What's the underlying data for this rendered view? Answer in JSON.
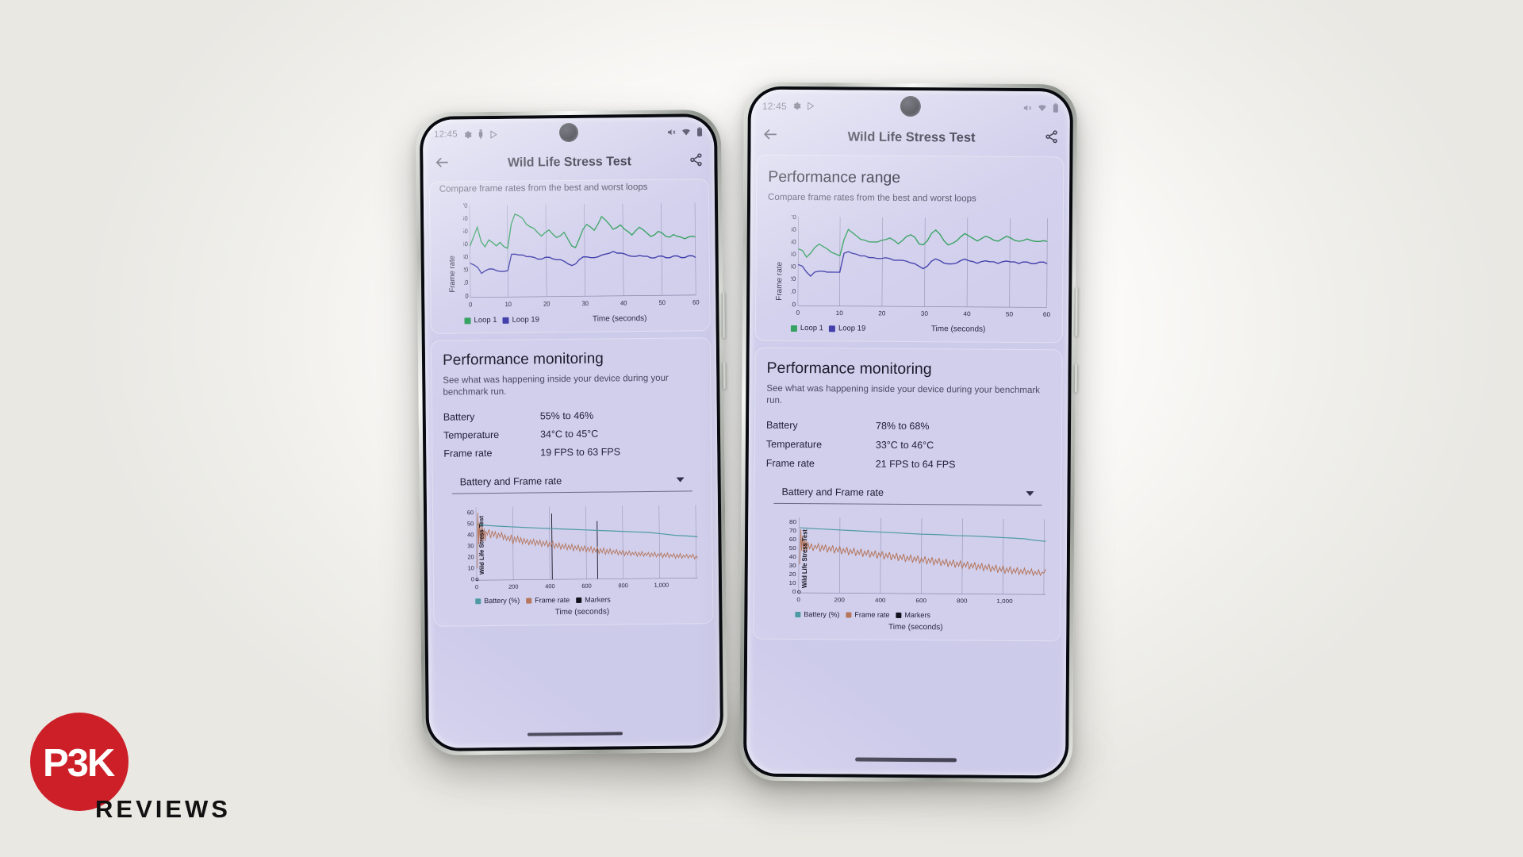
{
  "scene": {
    "background_color": "#f2f1ee",
    "watermark": {
      "brand_mark": "P3K",
      "brand_text": "REVIEWS",
      "brand_color": "#cd1f28"
    }
  },
  "phones": [
    {
      "id": "left-phone",
      "status_bar": {
        "time": "12:45",
        "left_icons": [
          "gear-icon",
          "usb-icon",
          "play-store-icon"
        ],
        "right_icons": [
          "mute-icon",
          "wifi-icon",
          "battery-icon"
        ]
      },
      "app_bar": {
        "back_icon": "back-arrow-icon",
        "title": "Wild Life Stress Test",
        "share_icon": "share-icon"
      },
      "performance_range": {
        "subtitle": "Compare frame rates from the best and worst loops",
        "axis_label_x": "Time (seconds)",
        "axis_label_y": "Frame rate",
        "legend": [
          {
            "label": "Loop 1",
            "color": "#2e9e5b"
          },
          {
            "label": "Loop 19",
            "color": "#3d3aa8"
          }
        ]
      },
      "performance_monitoring": {
        "title": "Performance monitoring",
        "subtitle": "See what was happening inside your device during your benchmark run.",
        "rows": [
          {
            "key": "Battery",
            "value": "55% to 46%"
          },
          {
            "key": "Temperature",
            "value": "34°C to 45°C"
          },
          {
            "key": "Frame rate",
            "value": "19 FPS to 63 FPS"
          }
        ],
        "dropdown_value": "Battery and Frame rate",
        "chart": {
          "axis_label_x": "Time (seconds)",
          "axis_label_y": "Wild Life Stress Test",
          "legend": [
            {
              "label": "Battery (%)",
              "color": "#4e9aa4"
            },
            {
              "label": "Frame rate",
              "color": "#b5765c"
            },
            {
              "label": "Markers",
              "color": "#11111e"
            }
          ]
        }
      }
    },
    {
      "id": "right-phone",
      "status_bar": {
        "time": "12:45",
        "left_icons": [
          "gear-icon",
          "play-store-icon"
        ],
        "right_icons": [
          "mute-icon",
          "wifi-icon",
          "battery-icon"
        ]
      },
      "app_bar": {
        "back_icon": "back-arrow-icon",
        "title": "Wild Life Stress Test",
        "share_icon": "share-icon"
      },
      "performance_range": {
        "title": "Performance range",
        "subtitle": "Compare frame rates from the best and worst loops",
        "axis_label_x": "Time (seconds)",
        "axis_label_y": "Frame rate",
        "legend": [
          {
            "label": "Loop 1",
            "color": "#2e9e5b"
          },
          {
            "label": "Loop 19",
            "color": "#3d3aa8"
          }
        ]
      },
      "performance_monitoring": {
        "title": "Performance monitoring",
        "subtitle": "See what was happening inside your device during your benchmark run.",
        "rows": [
          {
            "key": "Battery",
            "value": "78% to 68%"
          },
          {
            "key": "Temperature",
            "value": "33°C to 46°C"
          },
          {
            "key": "Frame rate",
            "value": "21 FPS to 64 FPS"
          }
        ],
        "dropdown_value": "Battery and Frame rate",
        "chart": {
          "axis_label_x": "Time (seconds)",
          "axis_label_y": "Wild Life Stress Test",
          "legend": [
            {
              "label": "Battery (%)",
              "color": "#4e9aa4"
            },
            {
              "label": "Frame rate",
              "color": "#b5765c"
            },
            {
              "label": "Markers",
              "color": "#11111e"
            }
          ]
        }
      }
    }
  ],
  "chart_data": [
    {
      "id": "left-performance-range",
      "type": "line",
      "title": "Performance range",
      "xlabel": "Time (seconds)",
      "ylabel": "Frame rate",
      "xlim": [
        0,
        60
      ],
      "ylim": [
        0,
        70
      ],
      "xticks": [
        0,
        10,
        20,
        30,
        40,
        50,
        60
      ],
      "yticks": [
        0,
        10,
        20,
        30,
        40,
        50,
        60,
        70
      ],
      "grid": true,
      "legend_position": "bottom-left",
      "series": [
        {
          "name": "Loop 1",
          "color": "#2e9e5b",
          "x": [
            0,
            1,
            2,
            3,
            4,
            5,
            6,
            7,
            8,
            9,
            10,
            11,
            12,
            13,
            14,
            15,
            16,
            17,
            18,
            19,
            20,
            21,
            22,
            23,
            24,
            25,
            26,
            27,
            28,
            29,
            30,
            31,
            32,
            33,
            34,
            35,
            36,
            37,
            38,
            39,
            40,
            41,
            42,
            43,
            44,
            45,
            46,
            47,
            48,
            49,
            50,
            51,
            52,
            53,
            54,
            55,
            56,
            57,
            58,
            59,
            60
          ],
          "values": [
            38,
            45,
            52,
            44,
            41,
            46,
            44,
            42,
            44,
            41,
            40,
            58,
            65,
            64,
            62,
            58,
            56,
            55,
            52,
            50,
            52,
            54,
            51,
            49,
            50,
            52,
            47,
            43,
            42,
            48,
            55,
            58,
            56,
            54,
            58,
            62,
            60,
            57,
            54,
            55,
            57,
            54,
            52,
            50,
            53,
            55,
            53,
            51,
            49,
            50,
            52,
            51,
            49,
            48,
            50,
            49,
            48,
            47,
            48,
            49,
            48
          ]
        },
        {
          "name": "Loop 19",
          "color": "#3d3aa8",
          "x": [
            0,
            1,
            2,
            3,
            4,
            5,
            6,
            7,
            8,
            9,
            10,
            11,
            12,
            13,
            14,
            15,
            16,
            17,
            18,
            19,
            20,
            21,
            22,
            23,
            24,
            25,
            26,
            27,
            28,
            29,
            30,
            31,
            32,
            33,
            34,
            35,
            36,
            37,
            38,
            39,
            40,
            41,
            42,
            43,
            44,
            45,
            46,
            47,
            48,
            49,
            50,
            51,
            52,
            53,
            54,
            55,
            56,
            57,
            58,
            59,
            60
          ],
          "values": [
            25,
            24,
            22,
            18,
            20,
            21,
            21,
            20,
            19,
            19,
            20,
            32,
            32,
            31,
            31,
            30,
            30,
            29,
            28,
            28,
            29,
            29,
            28,
            27,
            27,
            26,
            24,
            23,
            24,
            27,
            29,
            29,
            28,
            28,
            29,
            30,
            31,
            32,
            33,
            32,
            32,
            31,
            30,
            29,
            29,
            30,
            29,
            29,
            28,
            28,
            29,
            29,
            28,
            28,
            29,
            29,
            28,
            28,
            29,
            29,
            28
          ]
        }
      ]
    },
    {
      "id": "left-battery-frame-rate",
      "type": "line",
      "xlabel": "Time (seconds)",
      "ylabel": "Wild Life Stress Test",
      "xlim": [
        0,
        1200
      ],
      "ylim": [
        0,
        60
      ],
      "xticks": [
        0,
        200,
        400,
        600,
        800,
        1000
      ],
      "xticklabels": [
        "0",
        "200",
        "400",
        "600",
        "800",
        "1,000"
      ],
      "yticks": [
        0,
        10,
        20,
        30,
        40,
        50,
        60
      ],
      "grid": true,
      "legend_position": "bottom-left",
      "series": [
        {
          "name": "Battery (%)",
          "color": "#4e9aa4",
          "description": "slow linear decline from 55% to 46%"
        },
        {
          "name": "Frame rate",
          "color": "#b5765c",
          "description": "noisy oscillation declining from ~55 to ~25"
        },
        {
          "name": "Markers",
          "color": "#11111e",
          "description": "vertical marker spikes near 410s and 660s"
        }
      ]
    },
    {
      "id": "right-performance-range",
      "type": "line",
      "title": "Performance range",
      "xlabel": "Time (seconds)",
      "ylabel": "Frame rate",
      "xlim": [
        0,
        60
      ],
      "ylim": [
        0,
        70
      ],
      "xticks": [
        0,
        10,
        20,
        30,
        40,
        50,
        60
      ],
      "yticks": [
        0,
        10,
        20,
        30,
        40,
        50,
        60,
        70
      ],
      "grid": true,
      "legend_position": "bottom-left",
      "series": [
        {
          "name": "Loop 1",
          "color": "#2e9e5b",
          "x": [
            0,
            1,
            2,
            3,
            4,
            5,
            6,
            7,
            8,
            9,
            10,
            11,
            12,
            13,
            14,
            15,
            16,
            17,
            18,
            19,
            20,
            21,
            22,
            23,
            24,
            25,
            26,
            27,
            28,
            29,
            30,
            31,
            32,
            33,
            34,
            35,
            36,
            37,
            38,
            39,
            40,
            41,
            42,
            43,
            44,
            45,
            46,
            47,
            48,
            49,
            50,
            51,
            52,
            53,
            54,
            55,
            56,
            57,
            58,
            59,
            60
          ],
          "values": [
            44,
            43,
            38,
            41,
            45,
            48,
            46,
            44,
            42,
            40,
            39,
            52,
            60,
            58,
            55,
            53,
            52,
            51,
            51,
            51,
            52,
            53,
            54,
            52,
            50,
            53,
            56,
            57,
            55,
            50,
            49,
            52,
            58,
            60,
            57,
            52,
            49,
            50,
            52,
            55,
            58,
            56,
            54,
            52,
            54,
            56,
            55,
            53,
            52,
            54,
            56,
            55,
            53,
            52,
            53,
            54,
            53,
            52,
            52,
            53,
            52
          ]
        },
        {
          "name": "Loop 19",
          "color": "#3d3aa8",
          "x": [
            0,
            1,
            2,
            3,
            4,
            5,
            6,
            7,
            8,
            9,
            10,
            11,
            12,
            13,
            14,
            15,
            16,
            17,
            18,
            19,
            20,
            21,
            22,
            23,
            24,
            25,
            26,
            27,
            28,
            29,
            30,
            31,
            32,
            33,
            34,
            35,
            36,
            37,
            38,
            39,
            40,
            41,
            42,
            43,
            44,
            45,
            46,
            47,
            48,
            49,
            50,
            51,
            52,
            53,
            54,
            55,
            56,
            57,
            58,
            59,
            60
          ],
          "values": [
            32,
            31,
            26,
            23,
            26,
            27,
            27,
            26,
            26,
            26,
            26,
            40,
            41,
            40,
            39,
            38,
            38,
            37,
            37,
            36,
            36,
            37,
            36,
            35,
            35,
            35,
            34,
            33,
            32,
            30,
            28,
            30,
            34,
            36,
            35,
            33,
            32,
            32,
            33,
            35,
            36,
            35,
            34,
            33,
            34,
            35,
            34,
            34,
            33,
            34,
            35,
            34,
            34,
            33,
            34,
            34,
            33,
            33,
            34,
            34,
            33
          ]
        }
      ]
    },
    {
      "id": "right-battery-frame-rate",
      "type": "line",
      "xlabel": "Time (seconds)",
      "ylabel": "Wild Life Stress Test",
      "xlim": [
        0,
        1200
      ],
      "ylim": [
        0,
        80
      ],
      "xticks": [
        0,
        200,
        400,
        600,
        800,
        1000
      ],
      "xticklabels": [
        "0",
        "200",
        "400",
        "600",
        "800",
        "1,000"
      ],
      "yticks": [
        0,
        10,
        20,
        30,
        40,
        50,
        60,
        70,
        80
      ],
      "grid": true,
      "legend_position": "bottom-left",
      "series": [
        {
          "name": "Battery (%)",
          "color": "#4e9aa4",
          "description": "slow linear decline from 78% to 68%"
        },
        {
          "name": "Frame rate",
          "color": "#b5765c",
          "description": "noisy oscillation declining from ~55 to ~30"
        },
        {
          "name": "Markers",
          "color": "#11111e",
          "description": "no visible marker spikes"
        }
      ]
    }
  ]
}
